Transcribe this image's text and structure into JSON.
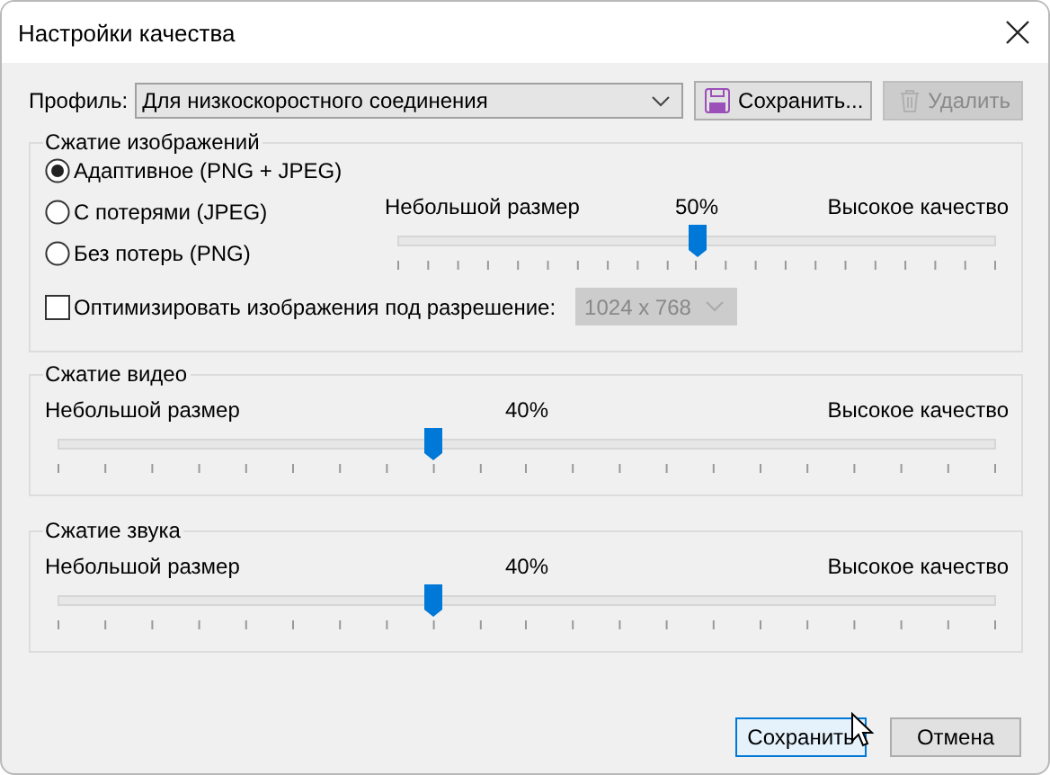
{
  "window": {
    "title": "Настройки качества"
  },
  "profile": {
    "label": "Профиль:",
    "value": "Для низкоскоростного соединения",
    "save_button": {
      "label": "Сохранить...",
      "disabled": false
    },
    "delete_button": {
      "label": "Удалить",
      "disabled": true
    }
  },
  "image_compression": {
    "title": "Сжатие изображений",
    "modes": [
      {
        "label": "Адаптивное (PNG + JPEG)",
        "selected": true
      },
      {
        "label": "С потерями (JPEG)",
        "selected": false
      },
      {
        "label": "Без потерь (PNG)",
        "selected": false
      }
    ],
    "slider": {
      "min_label": "Небольшой размер",
      "value_label": "50%",
      "max_label": "Высокое качество",
      "level": 0.5
    },
    "optimize": {
      "label": "Оптимизировать изображения под разрешение:",
      "checked": false,
      "resolution": "1024 x 768",
      "disabled": true
    }
  },
  "video_compression": {
    "title": "Сжатие видео",
    "slider": {
      "min_label": "Небольшой размер",
      "value_label": "40%",
      "max_label": "Высокое качество",
      "level": 0.4
    }
  },
  "audio_compression": {
    "title": "Сжатие звука",
    "slider": {
      "min_label": "Небольшой размер",
      "value_label": "40%",
      "max_label": "Высокое качество",
      "level": 0.4
    }
  },
  "buttons": [
    {
      "label": "Сохранить",
      "focused": true
    },
    {
      "label": "Отмена",
      "focused": false
    }
  ]
}
